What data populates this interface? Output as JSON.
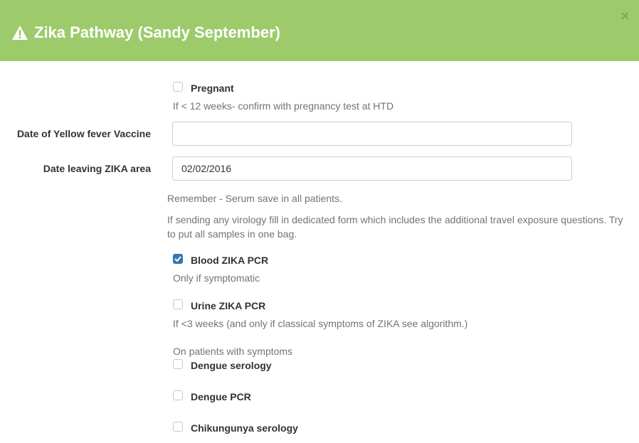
{
  "header": {
    "title": "Zika Pathway (Sandy September)",
    "close_symbol": "×",
    "color": "#9dcb6c",
    "icon": "warning-icon"
  },
  "pregnant": {
    "label": "Pregnant",
    "checked": false,
    "help": "If < 12 weeks- confirm with pregnancy test at HTD"
  },
  "yellow_fever": {
    "label": "Date of Yellow fever Vaccine",
    "value": ""
  },
  "date_leaving": {
    "label": "Date leaving ZIKA area",
    "value": "02/02/2016"
  },
  "notes": {
    "remember": "Remember - Serum save in all patients.",
    "virology": "If sending any virology fill in dedicated form which includes the additional travel exposure questions. Try to put all samples in one bag."
  },
  "blood_pcr": {
    "label": "Blood ZIKA PCR",
    "checked": true,
    "help": "Only if symptomatic"
  },
  "urine_pcr": {
    "label": "Urine ZIKA PCR",
    "checked": false,
    "help": "If <3 weeks (and only if classical symptoms of ZIKA see algorithm.)"
  },
  "symptoms_section": {
    "heading": "On patients with symptoms"
  },
  "dengue_serology": {
    "label": "Dengue serology",
    "checked": false
  },
  "dengue_pcr": {
    "label": "Dengue PCR",
    "checked": false
  },
  "chikungunya_serology": {
    "label": "Chikungunya serology",
    "checked": false
  },
  "colors": {
    "accent": "#337ab7",
    "header": "#9dcb6c"
  }
}
